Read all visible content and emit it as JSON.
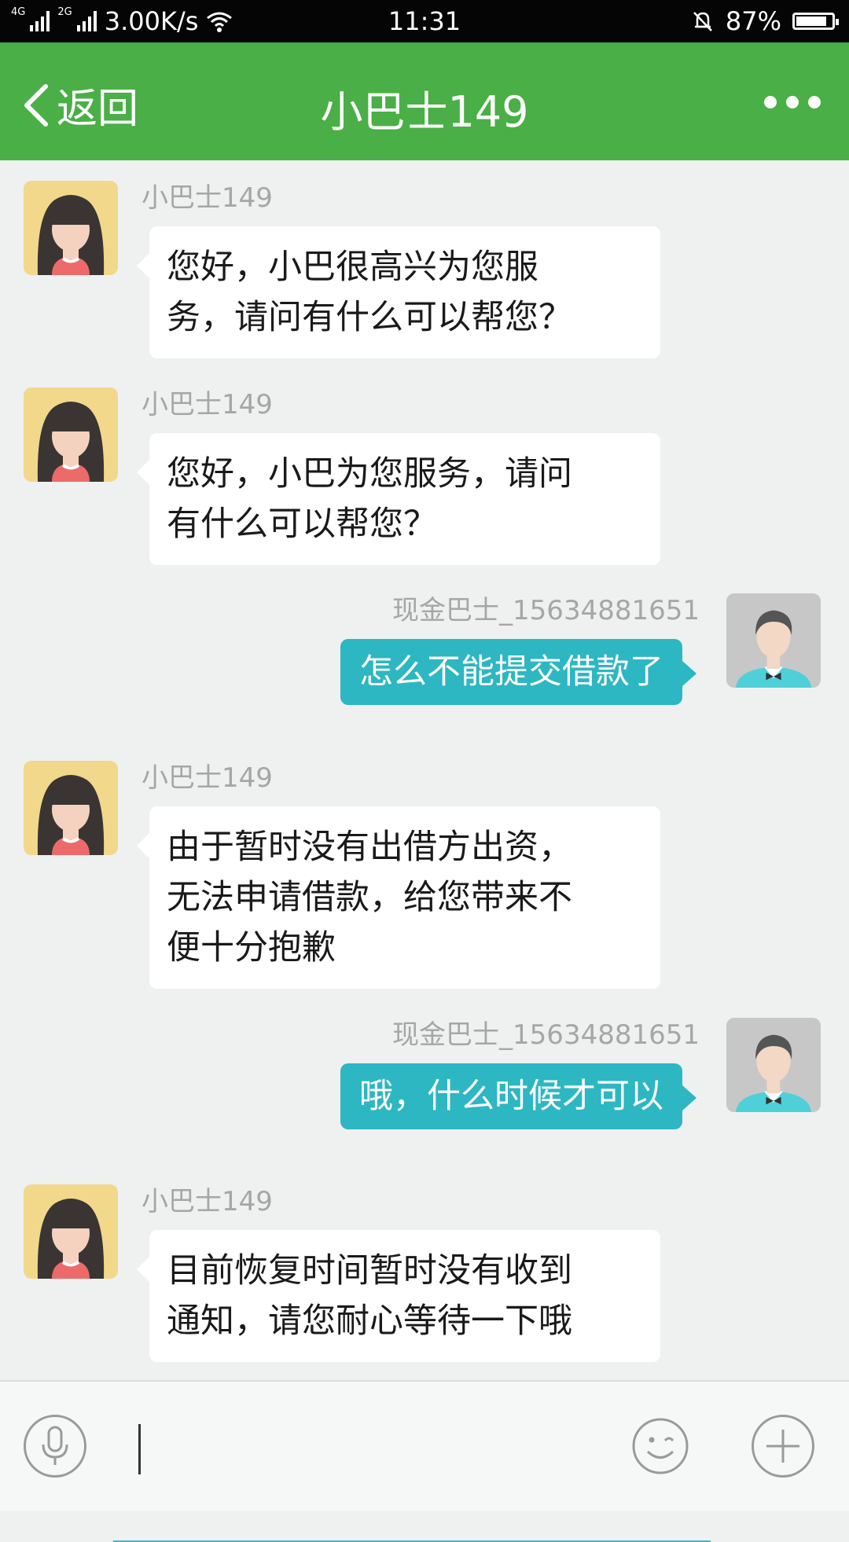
{
  "status_bar": {
    "net1": "4G",
    "net2": "2G",
    "speed": "3.00K/s",
    "time": "11:31",
    "battery_text": "87%",
    "battery_level": 0.87
  },
  "header": {
    "back_label": "返回",
    "title": "小巴士149"
  },
  "messages": [
    {
      "side": "left",
      "sender": "小巴士149",
      "lines": [
        "您好，小巴很高兴为您服",
        "务，请问有什么可以帮您？"
      ]
    },
    {
      "side": "left",
      "sender": "小巴士149",
      "lines": [
        "您好，小巴为您服务，请问",
        "有什么可以帮您？"
      ]
    },
    {
      "side": "right",
      "sender": "现金巴士_15634881651",
      "lines": [
        "怎么不能提交借款了"
      ]
    },
    {
      "side": "left",
      "sender": "小巴士149",
      "lines": [
        "由于暂时没有出借方出资，",
        "无法申请借款，给您带来不",
        "便十分抱歉"
      ]
    },
    {
      "side": "right",
      "sender": "现金巴士_15634881651",
      "lines": [
        "哦，什么时候才可以"
      ]
    },
    {
      "side": "left",
      "sender": "小巴士149",
      "lines": [
        "目前恢复时间暂时没有收到",
        "通知，请您耐心等待一下哦"
      ]
    }
  ],
  "input": {
    "value": ""
  },
  "colors": {
    "header_green": "#4aaf46",
    "outgoing_bubble": "#2cb7c2",
    "chat_background": "#eef1f0"
  },
  "icons": {
    "back": "chevron-left-icon",
    "more": "more-dots-icon",
    "voice": "microphone-icon",
    "emoji": "emoji-icon",
    "plus": "plus-icon"
  }
}
